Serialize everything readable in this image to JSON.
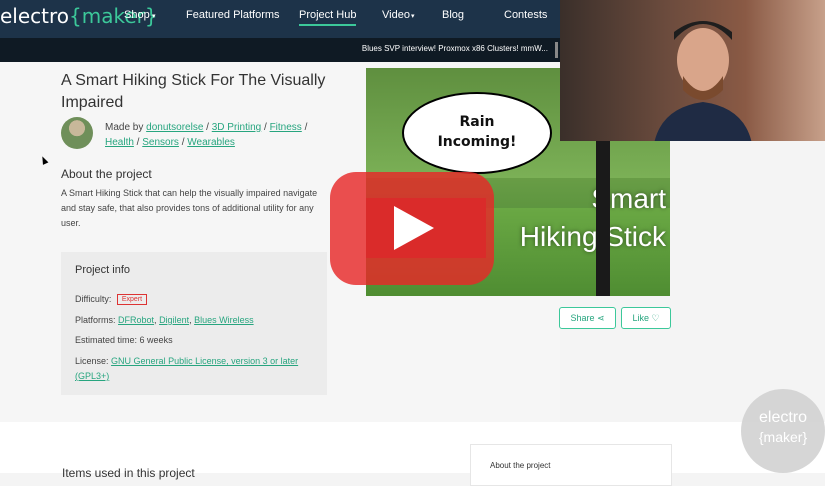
{
  "nav": {
    "logo_main": "electro",
    "logo_brace": "{maker}",
    "items": [
      "Shop",
      "Featured Platforms",
      "Project Hub",
      "Video",
      "Blog",
      "Contests"
    ],
    "active": "Project Hub"
  },
  "ticker": "Blues SVP interview! Proxmox x86 Clusters! mmW...",
  "project": {
    "title": "A Smart Hiking Stick For The Visually Impaired",
    "made_by_prefix": "Made by",
    "author": "donutsorelse",
    "tags": [
      "3D Printing",
      "Fitness",
      "Health",
      "Sensors",
      "Wearables"
    ]
  },
  "about": {
    "heading": "About the project",
    "text": "A Smart Hiking Stick that can help the visually impaired navigate and stay safe, that also provides tons of additional utility for any user."
  },
  "info": {
    "heading": "Project info",
    "difficulty_label": "Difficulty:",
    "difficulty_value": "Expert",
    "platforms_label": "Platforms:",
    "platforms": [
      "DFRobot",
      "Digilent",
      "Blues Wireless"
    ],
    "time_label": "Estimated time:",
    "time_value": "6 weeks",
    "license_label": "License:",
    "license_value": "GNU General Public License, version 3 or later (GPL3+)"
  },
  "video": {
    "bubble": "Rain\nIncoming!",
    "title": "Smart\nHiking Stick"
  },
  "actions": {
    "share": "Share",
    "like": "Like"
  },
  "lower": {
    "heading": "Items used in this project",
    "side_card": "About the project"
  },
  "watermark": {
    "line1": "electro",
    "line2": "{maker}"
  },
  "colors": {
    "nav": "#1d3349",
    "accent": "#3cc89a",
    "play": "#e62828"
  }
}
